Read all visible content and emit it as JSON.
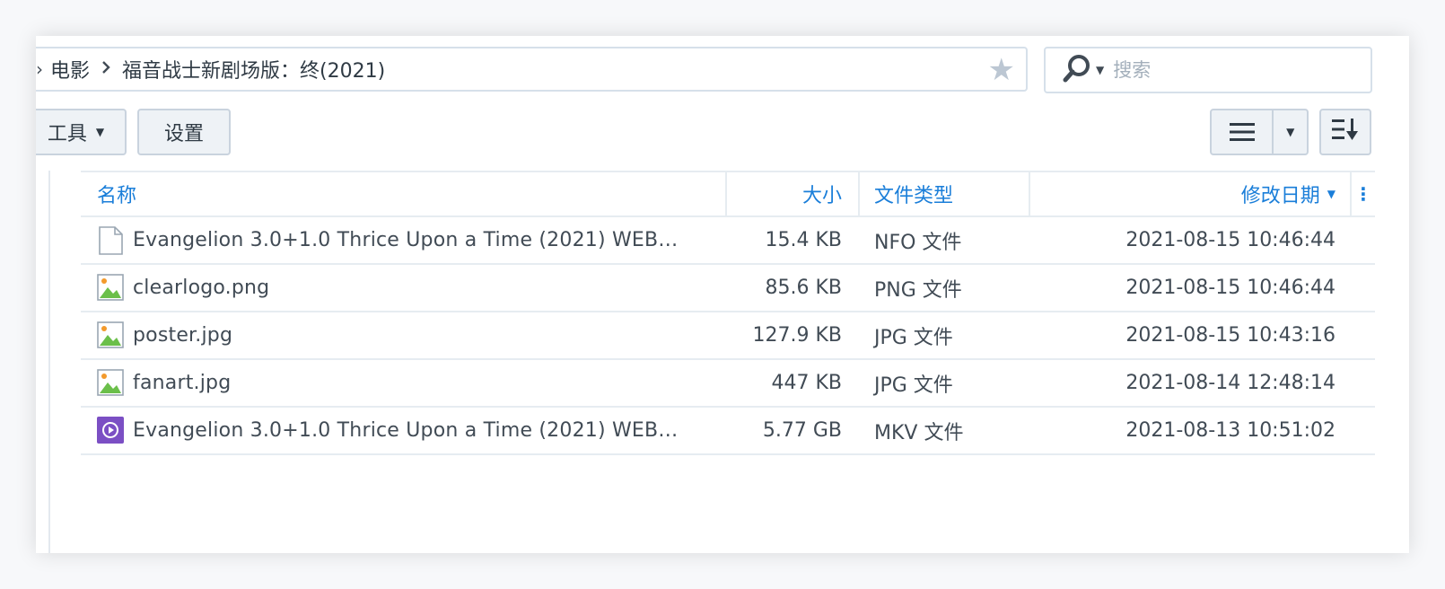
{
  "path": {
    "crumbs": [
      "电影",
      "福音战士新剧场版：终(2021)"
    ],
    "favorite_icon": "star-icon"
  },
  "search": {
    "placeholder": "搜索",
    "icon": "search-icon"
  },
  "toolbar": {
    "tools_label": "工具",
    "settings_label": "设置",
    "view_icon": "list-view-icon",
    "sort_icon": "sort-icon"
  },
  "table": {
    "headers": {
      "name": "名称",
      "size": "大小",
      "type": "文件类型",
      "modified": "修改日期"
    },
    "rows": [
      {
        "icon": "document-icon",
        "name": "Evangelion 3.0+1.0 Thrice Upon a Time (2021) WEB…",
        "size": "15.4 KB",
        "type": "NFO 文件",
        "modified": "2021-08-15 10:46:44"
      },
      {
        "icon": "image-icon",
        "name": "clearlogo.png",
        "size": "85.6 KB",
        "type": "PNG 文件",
        "modified": "2021-08-15 10:46:44"
      },
      {
        "icon": "image-icon",
        "name": "poster.jpg",
        "size": "127.9 KB",
        "type": "JPG 文件",
        "modified": "2021-08-15 10:43:16"
      },
      {
        "icon": "image-icon",
        "name": "fanart.jpg",
        "size": "447 KB",
        "type": "JPG 文件",
        "modified": "2021-08-14 12:48:14"
      },
      {
        "icon": "video-icon",
        "name": "Evangelion 3.0+1.0 Thrice Upon a Time (2021) WEB…",
        "size": "5.77 GB",
        "type": "MKV 文件",
        "modified": "2021-08-13 10:51:02"
      }
    ]
  },
  "colors": {
    "accent": "#1a7ed9",
    "video": "#7b4fc4",
    "image_green": "#6bbf4a"
  }
}
